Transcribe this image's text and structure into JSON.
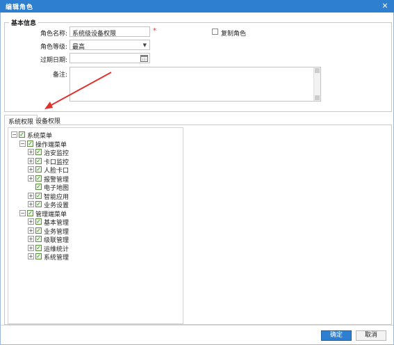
{
  "window": {
    "title": "编辑角色",
    "close_icon": "close-icon"
  },
  "basic": {
    "legend": "基本信息",
    "role_name_label": "角色名称:",
    "role_name_value": "系统级设备权限",
    "required_mark": "*",
    "copy_role_label": "复制角色",
    "role_level_label": "角色等级:",
    "role_level_value": "最高",
    "expire_label": "过期日期:",
    "expire_value": "",
    "remark_label": "备注:"
  },
  "tabs": [
    {
      "label": "系统权限",
      "active": true
    },
    {
      "label": "设备权限",
      "active": false
    }
  ],
  "tree": [
    {
      "label": "系统菜单",
      "level": 0,
      "expander": "−",
      "checked": true
    },
    {
      "label": "操作端菜单",
      "level": 1,
      "expander": "−",
      "checked": true
    },
    {
      "label": "治安监控",
      "level": 2,
      "expander": "+",
      "checked": true
    },
    {
      "label": "卡口监控",
      "level": 2,
      "expander": "+",
      "checked": true
    },
    {
      "label": "人脸卡口",
      "level": 2,
      "expander": "+",
      "checked": true
    },
    {
      "label": "报警管理",
      "level": 2,
      "expander": "+",
      "checked": true
    },
    {
      "label": "电子地图",
      "level": 2,
      "expander": "",
      "checked": true
    },
    {
      "label": "智能应用",
      "level": 2,
      "expander": "+",
      "checked": true
    },
    {
      "label": "业务设置",
      "level": 2,
      "expander": "+",
      "checked": true
    },
    {
      "label": "管理端菜单",
      "level": 1,
      "expander": "−",
      "checked": true
    },
    {
      "label": "基本管理",
      "level": 2,
      "expander": "+",
      "checked": true
    },
    {
      "label": "业务管理",
      "level": 2,
      "expander": "+",
      "checked": true
    },
    {
      "label": "级联管理",
      "level": 2,
      "expander": "+",
      "checked": true
    },
    {
      "label": "运维统计",
      "level": 2,
      "expander": "+",
      "checked": true
    },
    {
      "label": "系统管理",
      "level": 2,
      "expander": "+",
      "checked": true
    }
  ],
  "footer": {
    "ok_label": "确定",
    "cancel_label": "取消"
  },
  "colors": {
    "accent": "#2f7fd1",
    "annotation_arrow": "#e0312c",
    "check": "#2e7d1c"
  }
}
